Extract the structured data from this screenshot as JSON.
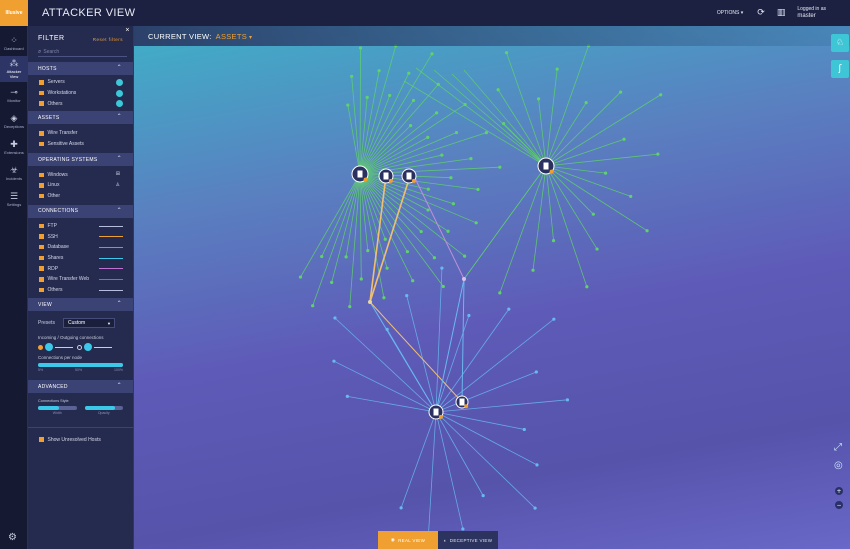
{
  "rail": {
    "logo": "Illusive",
    "items": [
      {
        "label": "Dashboard",
        "icon": "dashboard-icon"
      },
      {
        "label": "Attacker View",
        "icon": "attacker-view-icon",
        "active": true
      },
      {
        "label": "Monitor",
        "icon": "monitor-icon"
      },
      {
        "label": "Deceptions",
        "icon": "deceptions-icon"
      },
      {
        "label": "Extensions",
        "icon": "puzzle-icon"
      },
      {
        "label": "Incidents",
        "icon": "incidents-icon"
      },
      {
        "label": "Settings",
        "icon": "settings-icon"
      }
    ]
  },
  "header": {
    "title": "ATTACKER VIEW",
    "options": "OPTIONS",
    "logged_in_as": "Logged in as",
    "username": "master"
  },
  "filter": {
    "title": "FILTER",
    "reset": "Reset filters",
    "search_placeholder": "Search",
    "hosts": {
      "title": "HOSTS",
      "items": [
        "Servers",
        "Workstations",
        "Others"
      ]
    },
    "assets": {
      "title": "ASSETS",
      "items": [
        "Wire Transfer",
        "Sensitive Assets"
      ]
    },
    "operating_systems": {
      "title": "OPERATING SYSTEMS",
      "items": [
        "Windows",
        "Linux",
        "Other"
      ]
    },
    "connections": {
      "title": "CONNECTIONS",
      "items": [
        {
          "label": "FTP",
          "color": "#b8bde0"
        },
        {
          "label": "SSH",
          "color": "#f0a030"
        },
        {
          "label": "Database",
          "color": "#8a8fc0"
        },
        {
          "label": "Shares",
          "color": "#3cc8e8"
        },
        {
          "label": "RDP",
          "color": "#c070d0"
        },
        {
          "label": "Wire Transfer Web",
          "color": "#d84a8a"
        },
        {
          "label": "Others",
          "color": "#b8bde0"
        }
      ]
    },
    "view": {
      "title": "VIEW",
      "presets_label": "Presets",
      "preset_value": "Custom",
      "incoming_outgoing": "Incoming / Outgoing connections",
      "connections_per_node": "Connections per node",
      "ticks": [
        "5%",
        "50%",
        "100%"
      ],
      "connections_per_node_value": 1.0
    },
    "advanced": {
      "title": "ADVANCED",
      "connections_style": "Connections Style",
      "width_label": "Width",
      "opacity_label": "Opacity",
      "width_value": 0.55,
      "opacity_value": 0.8
    },
    "show_unresolved": "Show Unresolved Hosts"
  },
  "map": {
    "current_view_label": "CURRENT VIEW:",
    "current_view_value": "ASSETS",
    "tabs": {
      "real": "REAL VIEW",
      "deceptive": "DECEPTIVE VIEW"
    },
    "colors": {
      "green": "#5fd36a",
      "blue": "#6ab8f0",
      "orange": "#f0c070",
      "purple": "#c090d8"
    }
  }
}
